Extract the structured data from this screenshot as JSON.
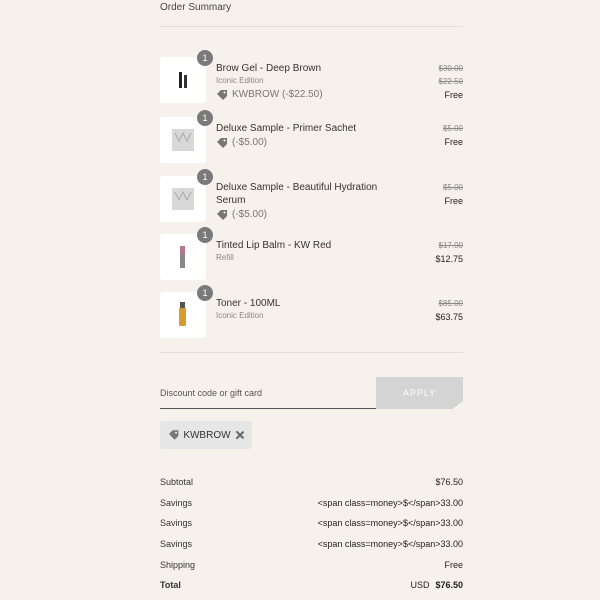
{
  "header": {
    "title": "Order Summary"
  },
  "items": [
    {
      "name": "Brow Gel - Deep Brown",
      "sub": "Iconic Edition",
      "discount": "KWBROW (-$22.50)",
      "qty": "1",
      "strike": [
        "$30.00",
        "$22.50"
      ],
      "final": "Free"
    },
    {
      "name": "Deluxe Sample - Primer Sachet",
      "sub": "",
      "discount": "(-$5.00)",
      "qty": "1",
      "strike": [
        "$5.00"
      ],
      "final": "Free"
    },
    {
      "name": "Deluxe Sample - Beautiful Hydration Serum",
      "sub": "",
      "discount": "(-$5.00)",
      "qty": "1",
      "strike": [
        "$5.00"
      ],
      "final": "Free"
    },
    {
      "name": "Tinted Lip Balm - KW Red",
      "sub": "Refill",
      "discount": "",
      "qty": "1",
      "strike": [
        "$17.00"
      ],
      "final": "$12.75"
    },
    {
      "name": "Toner - 100ML",
      "sub": "Iconic Edition",
      "discount": "",
      "qty": "1",
      "strike": [
        "$85.00"
      ],
      "final": "$63.75"
    }
  ],
  "discount": {
    "placeholder": "Discount code or gift card",
    "apply_label": "APPLY",
    "applied_code": "KWBROW"
  },
  "summary": {
    "subtotal_label": "Subtotal",
    "subtotal_value": "$76.50",
    "savings_label": "Savings",
    "savings_value": "<span class=money>$</span>33.00",
    "shipping_label": "Shipping",
    "shipping_value": "Free",
    "total_label": "Total",
    "total_currency": "USD",
    "total_value": "$76.50"
  }
}
